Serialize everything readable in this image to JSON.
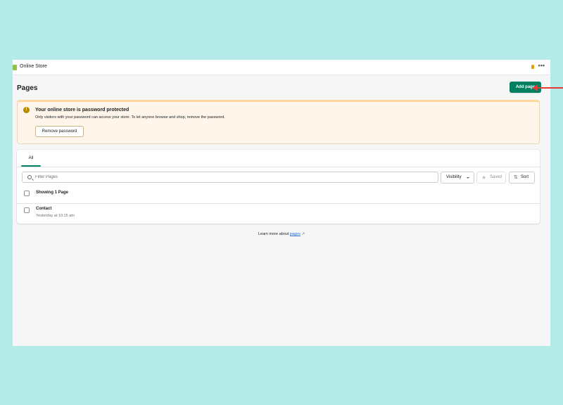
{
  "topbar": {
    "app_name": "Online Store",
    "more_icon": "•••"
  },
  "header": {
    "title": "Pages",
    "add_button": "Add page"
  },
  "banner": {
    "title": "Your online store is password protected",
    "text": "Only visitors with your password can access your store. To let anyone browse and shop, remove the password.",
    "button": "Remove password",
    "icon": "!"
  },
  "tabs": [
    {
      "label": "All",
      "selected": true
    }
  ],
  "filters": {
    "search_placeholder": "Filter Pages",
    "visibility_label": "Visibility",
    "saved_label": "Saved",
    "sort_label": "Sort"
  },
  "list": {
    "count_text": "Showing 1 Page",
    "rows": [
      {
        "title": "Contact",
        "subtitle": "Yesterday at 10:15 am"
      }
    ]
  },
  "footer": {
    "prefix": "Learn more about ",
    "link": "pages"
  },
  "colors": {
    "primary": "#008060",
    "warning_bg": "#fff5ea",
    "link": "#2c6ecb",
    "annotation_arrow": "#e53935"
  }
}
